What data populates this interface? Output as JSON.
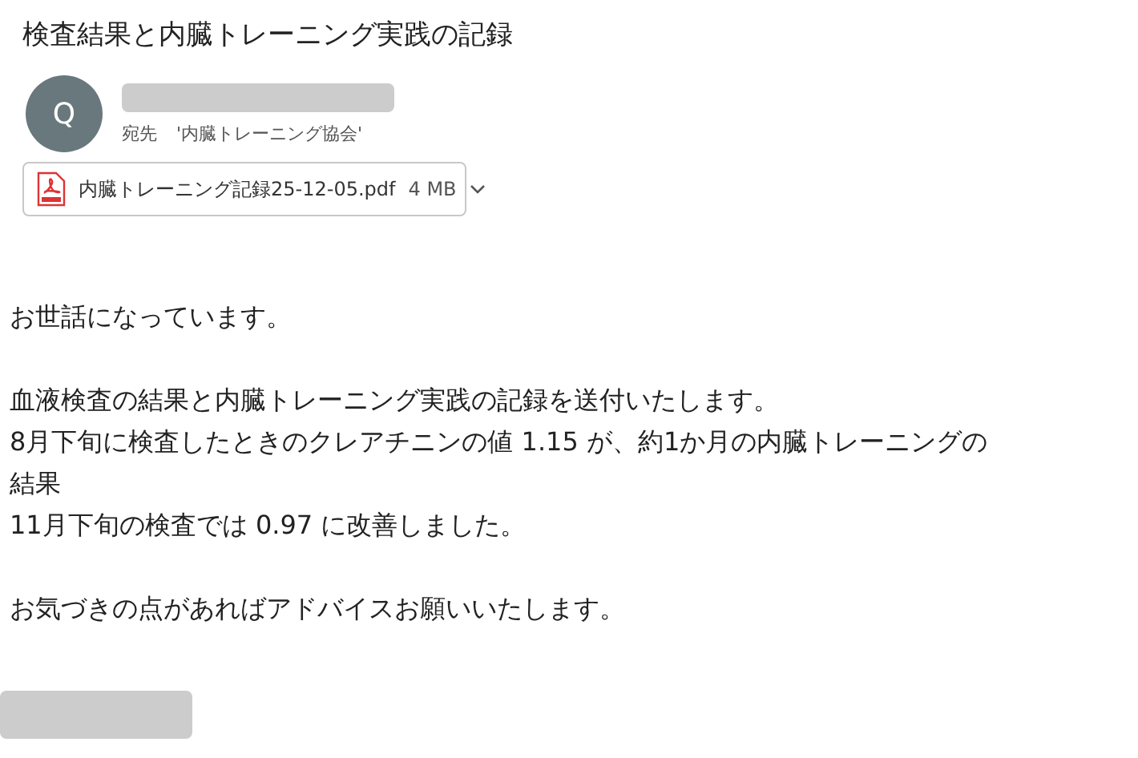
{
  "subject": "検査結果と内臓トレーニング実践の記録",
  "sender": {
    "initial": "Q",
    "to_label": "宛先",
    "to_value": "'内臓トレーニング協会'"
  },
  "attachment": {
    "name": "内臓トレーニング記録25-12-05.pdf",
    "size": "4 MB"
  },
  "body": [
    [
      "お世話になっています。"
    ],
    [
      "血液検査の結果と内臓トレーニング実践の記録を送付いたします。",
      "8月下旬に検査したときのクレアチニンの値 1.15 が、約1か月の内臓トレーニングの",
      "結果",
      "11月下旬の検査では 0.97 に改善しました。"
    ],
    [
      "お気づきの点があればアドバイスお願いいたします。"
    ]
  ]
}
